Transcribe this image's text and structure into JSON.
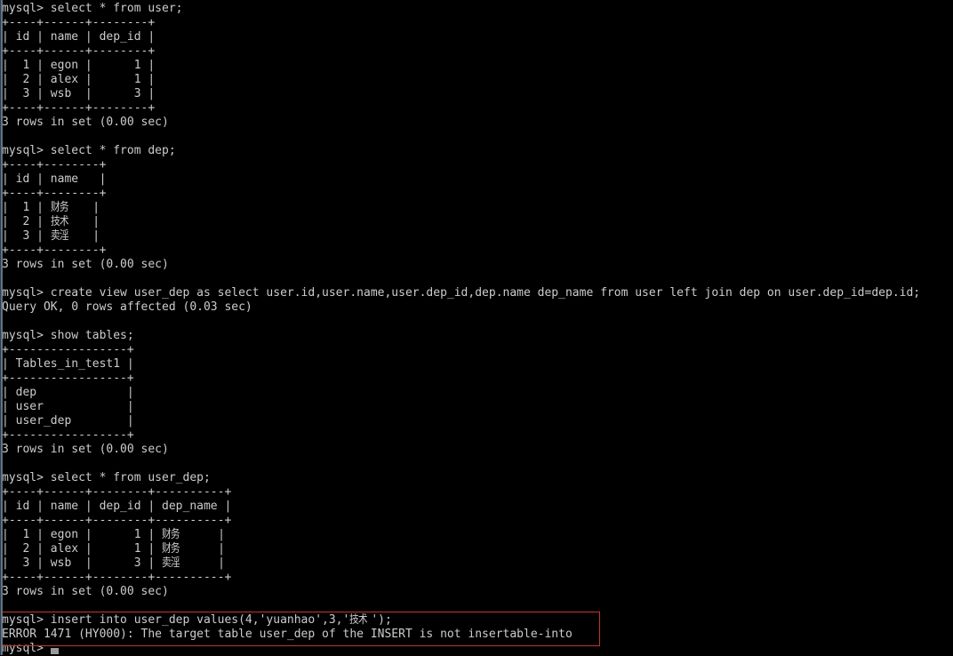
{
  "window": {
    "type": "terminal",
    "title": "mysql command line client",
    "background_color": "#000000",
    "foreground_color": "#cccccc",
    "annotation_color": "#c0392b",
    "cursor_color": "#9a9a9a"
  },
  "annotation": {
    "name": "error-highlight-box",
    "description": "red rectangle around the failed INSERT statement and its ERROR output"
  },
  "prompt": "mysql>",
  "lines": [
    "mysql> select * from user;",
    "+----+------+--------+",
    "| id | name | dep_id |",
    "+----+------+--------+",
    "|  1 | egon |      1 |",
    "|  2 | alex |      1 |",
    "|  3 | wsb  |      3 |",
    "+----+------+--------+",
    "3 rows in set (0.00 sec)",
    "",
    "mysql> select * from dep;",
    "+----+--------+",
    "| id | name   |",
    "+----+--------+",
    "|  1 | 财务   |",
    "|  2 | 技术   |",
    "|  3 | 卖淫   |",
    "+----+--------+",
    "3 rows in set (0.00 sec)",
    "",
    "mysql> create view user_dep as select user.id,user.name,user.dep_id,dep.name dep_name from user left join dep on user.dep_id=dep.id;",
    "Query OK, 0 rows affected (0.03 sec)",
    "",
    "mysql> show tables;",
    "+-----------------+",
    "| Tables_in_test1 |",
    "+-----------------+",
    "| dep             |",
    "| user            |",
    "| user_dep        |",
    "+-----------------+",
    "3 rows in set (0.00 sec)",
    "",
    "mysql> select * from user_dep;",
    "+----+------+--------+----------+",
    "| id | name | dep_id | dep_name |",
    "+----+------+--------+----------+",
    "|  1 | egon |      1 | 财务     |",
    "|  2 | alex |      1 | 财务     |",
    "|  3 | wsb  |      3 | 卖淫     |",
    "+----+------+--------+----------+",
    "3 rows in set (0.00 sec)",
    "",
    "mysql> insert into user_dep values(4,'yuanhao',3,'技术');",
    "ERROR 1471 (HY000): The target table user_dep of the INSERT is not insertable-into",
    "mysql>"
  ]
}
